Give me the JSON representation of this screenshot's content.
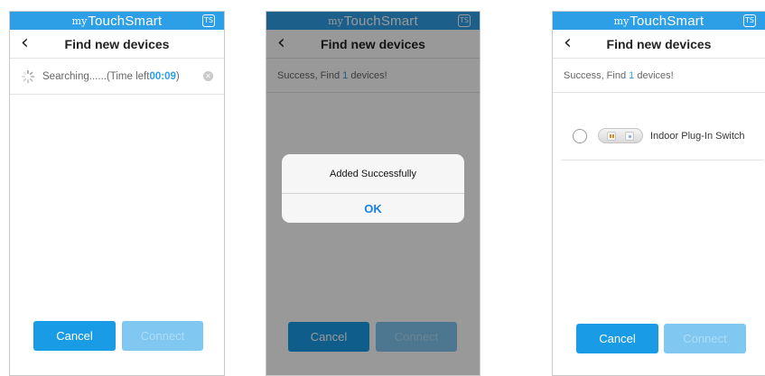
{
  "app": {
    "brand_prefix": "my",
    "brand_name": "TouchSmart",
    "logo_glyph": "TS"
  },
  "nav": {
    "back_glyph": "‹",
    "title": "Find new devices"
  },
  "screen1": {
    "searching_prefix": "Searching......(Time left ",
    "time_left": "00:09",
    "searching_suffix": ")",
    "clear_glyph": "✕"
  },
  "success": {
    "prefix": "Success, Find ",
    "count": "1",
    "suffix": " devices!"
  },
  "dialog": {
    "message": "Added Successfully",
    "ok_label": "OK"
  },
  "device": {
    "name": "Indoor Plug-In Switch",
    "icon": "plug-switch-icon"
  },
  "buttons": {
    "cancel_label": "Cancel",
    "connect_label": "Connect"
  },
  "colors": {
    "accent": "#2d9fe6",
    "button": "#1a9be6",
    "dialog_ok": "#1a7fe0"
  }
}
